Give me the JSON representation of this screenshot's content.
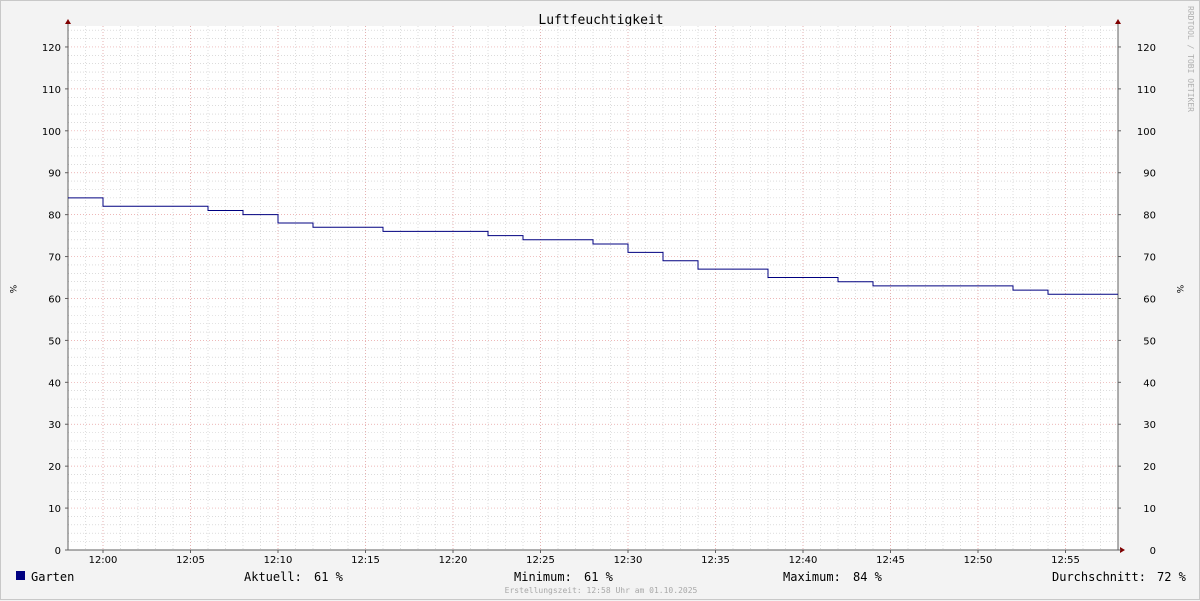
{
  "chart_data": {
    "type": "line",
    "title": "Luftfeuchtigkeit",
    "unit_label": "%",
    "watermark": "RRDTOOL / TOBI OETIKER",
    "ylim": [
      0,
      125
    ],
    "y_ticks": [
      0,
      10,
      20,
      30,
      40,
      50,
      60,
      70,
      80,
      90,
      100,
      110,
      120
    ],
    "x_range": [
      "11:58",
      "12:58"
    ],
    "x_tick_labels": [
      "12:00",
      "12:05",
      "12:10",
      "12:15",
      "12:20",
      "12:25",
      "12:30",
      "12:35",
      "12:40",
      "12:45",
      "12:50",
      "12:55"
    ],
    "grid": true,
    "colors": {
      "background": "#f3f3f3",
      "plot_background": "#ffffff",
      "series": "#000080",
      "major_grid": "#e8a0a0",
      "minor_grid": "#c8c8c8",
      "axis": "#606060",
      "arrow": "#800000"
    },
    "series": [
      {
        "name": "Garten",
        "color": "#000080",
        "step": true,
        "x": [
          "11:58",
          "12:00",
          "12:06",
          "12:08",
          "12:10",
          "12:12",
          "12:16",
          "12:22",
          "12:24",
          "12:28",
          "12:30",
          "12:32",
          "12:34",
          "12:38",
          "12:42",
          "12:44",
          "12:52",
          "12:54",
          "12:58"
        ],
        "values": [
          84,
          82,
          81,
          80,
          78,
          77,
          76,
          75,
          74,
          73,
          71,
          69,
          67,
          65,
          64,
          63,
          62,
          61,
          61
        ]
      }
    ],
    "legend": {
      "name": "Garten",
      "aktuell_label": "Aktuell:",
      "aktuell_value": "61 %",
      "minimum_label": "Minimum:",
      "minimum_value": "61 %",
      "maximum_label": "Maximum:",
      "maximum_value": "84 %",
      "durchschnitt_label": "Durchschnitt:",
      "durchschnitt_value": "72 %"
    },
    "footer": "Erstellungszeit: 12:58 Uhr am 01.10.2025"
  }
}
